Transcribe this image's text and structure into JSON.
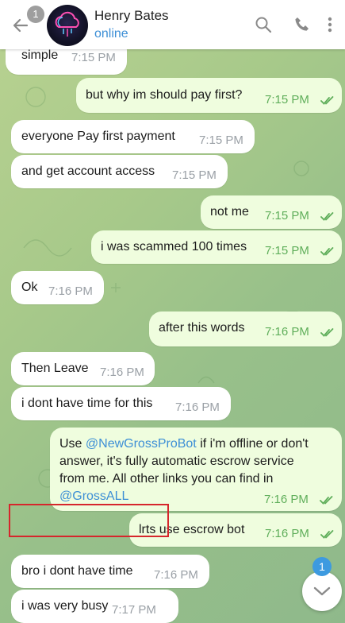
{
  "header": {
    "unread_count": "1",
    "contact_name": "Henry Bates",
    "contact_status": "online"
  },
  "messages": [
    {
      "text": "simple",
      "time": "7:15 PM",
      "direction": "in"
    },
    {
      "text": "but why im should pay first?",
      "time": "7:15 PM",
      "direction": "out"
    },
    {
      "text": "everyone Pay  first payment",
      "time": "7:15 PM",
      "direction": "in"
    },
    {
      "text": "and get account access",
      "time": "7:15 PM",
      "direction": "in"
    },
    {
      "text": "not me",
      "time": "7:15 PM",
      "direction": "out"
    },
    {
      "text": "i was scammed 100 times",
      "time": "7:15 PM",
      "direction": "out"
    },
    {
      "text": "Ok",
      "time": "7:16 PM",
      "direction": "in"
    },
    {
      "text": "after this words",
      "time": "7:16 PM",
      "direction": "out"
    },
    {
      "text": "Then Leave",
      "time": "7:16 PM",
      "direction": "in"
    },
    {
      "text": "i dont have time for this",
      "time": "7:16 PM",
      "direction": "in"
    },
    {
      "direction": "out",
      "time": "7:16 PM",
      "line1_pre": "Use ",
      "line1_link": "@NewGrossProBot",
      "line1_post": " if i'm offline or don't",
      "line2": "answer, it's fully automatic escrow service",
      "line3": "from me. All other links you can find in",
      "line4_link": "@GrossALL"
    },
    {
      "text": "lrts use escrow bot",
      "time": "7:16 PM",
      "direction": "out"
    },
    {
      "text": "bro i dont have time",
      "time": "7:16 PM",
      "direction": "in"
    },
    {
      "text": "i was very busy",
      "time": "7:17 PM",
      "direction": "in"
    }
  ],
  "scroll_down": {
    "badge": "1"
  },
  "colors": {
    "accent": "#3d8fd6",
    "incoming_bubble": "#ffffff",
    "outgoing_bubble": "#effdde",
    "read_ticks": "#5fae5a",
    "highlight_box": "#d6262c"
  },
  "icons": [
    "back-arrow-icon",
    "search-icon",
    "phone-icon",
    "more-vertical-icon",
    "chevron-down-icon",
    "double-check-icon"
  ]
}
